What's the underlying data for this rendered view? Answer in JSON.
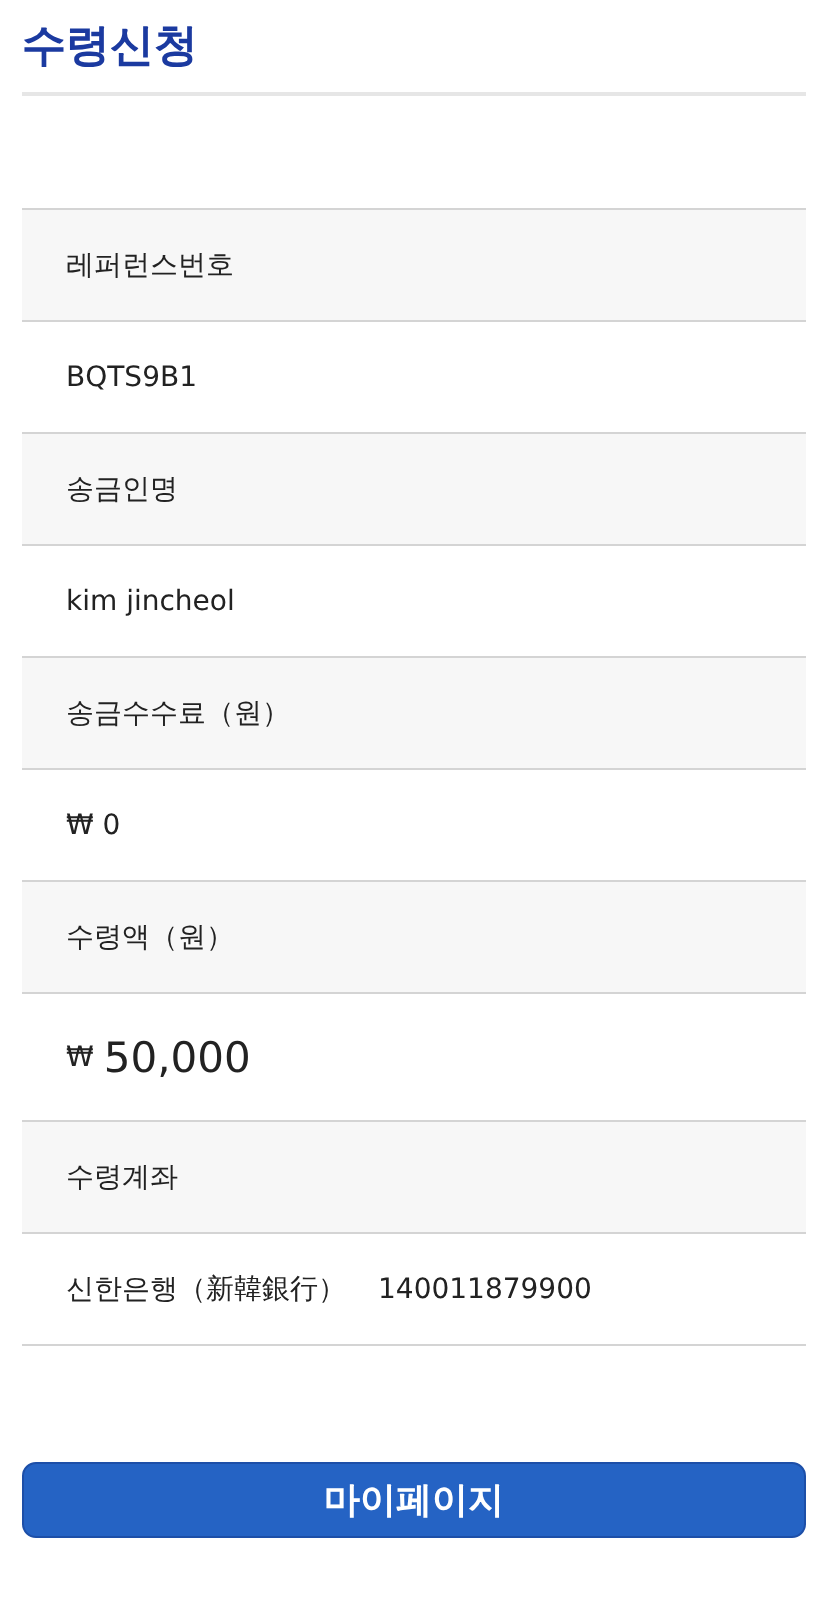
{
  "title": "수령신청",
  "rows": [
    {
      "kind": "label",
      "text": "레퍼런스번호"
    },
    {
      "kind": "value",
      "text": "BQTS9B1"
    },
    {
      "kind": "label",
      "text": "송금인명"
    },
    {
      "kind": "value",
      "text": "kim jincheol"
    },
    {
      "kind": "label",
      "text": "송금수수료（원）"
    },
    {
      "kind": "value",
      "text": "₩ 0"
    },
    {
      "kind": "label",
      "text": "수령액（원）"
    },
    {
      "kind": "amount",
      "currency": "₩",
      "text": "50,000"
    },
    {
      "kind": "label",
      "text": "수령계좌"
    },
    {
      "kind": "account",
      "bank": "신한은행（新韓銀行）",
      "text": "140011879900"
    }
  ],
  "button": "마이페이지"
}
